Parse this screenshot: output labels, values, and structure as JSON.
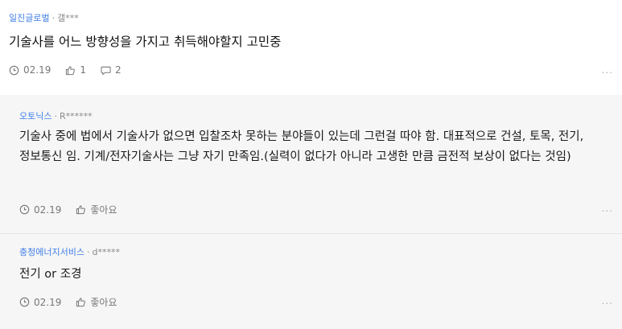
{
  "post": {
    "company": "일진글로벌",
    "author": "갤***",
    "title": "기술사를 어느 방향성을 가지고 취득해야할지 고민중",
    "date": "02.19",
    "likes": "1",
    "comments": "2",
    "more": "..."
  },
  "comments": [
    {
      "company": "오토닉스",
      "author": "R******",
      "body": "기술사 중에 법에서 기술사가 없으면 입찰조차 못하는 분야들이 있는데 그런걸 따야 함. 대표적으로 건설, 토목, 전기, 정보통신 임. 기계/전자기술사는 그냥 자기 만족임.(실력이 없다가 아니라 고생한 만큼 금전적 보상이 없다는 것임)",
      "date": "02.19",
      "like_label": "좋아요",
      "more": "..."
    },
    {
      "company": "충청에너지서비스",
      "author": "d*****",
      "body": "전기 or 조경",
      "date": "02.19",
      "like_label": "좋아요",
      "more": "..."
    }
  ],
  "separator": "·",
  "icons": {
    "clock": "clock-icon",
    "like": "thumbs-up-icon",
    "comment": "comment-bubble-icon"
  },
  "colors": {
    "company": "#3f7ee8",
    "comment_bg": "#f6f6f6"
  }
}
